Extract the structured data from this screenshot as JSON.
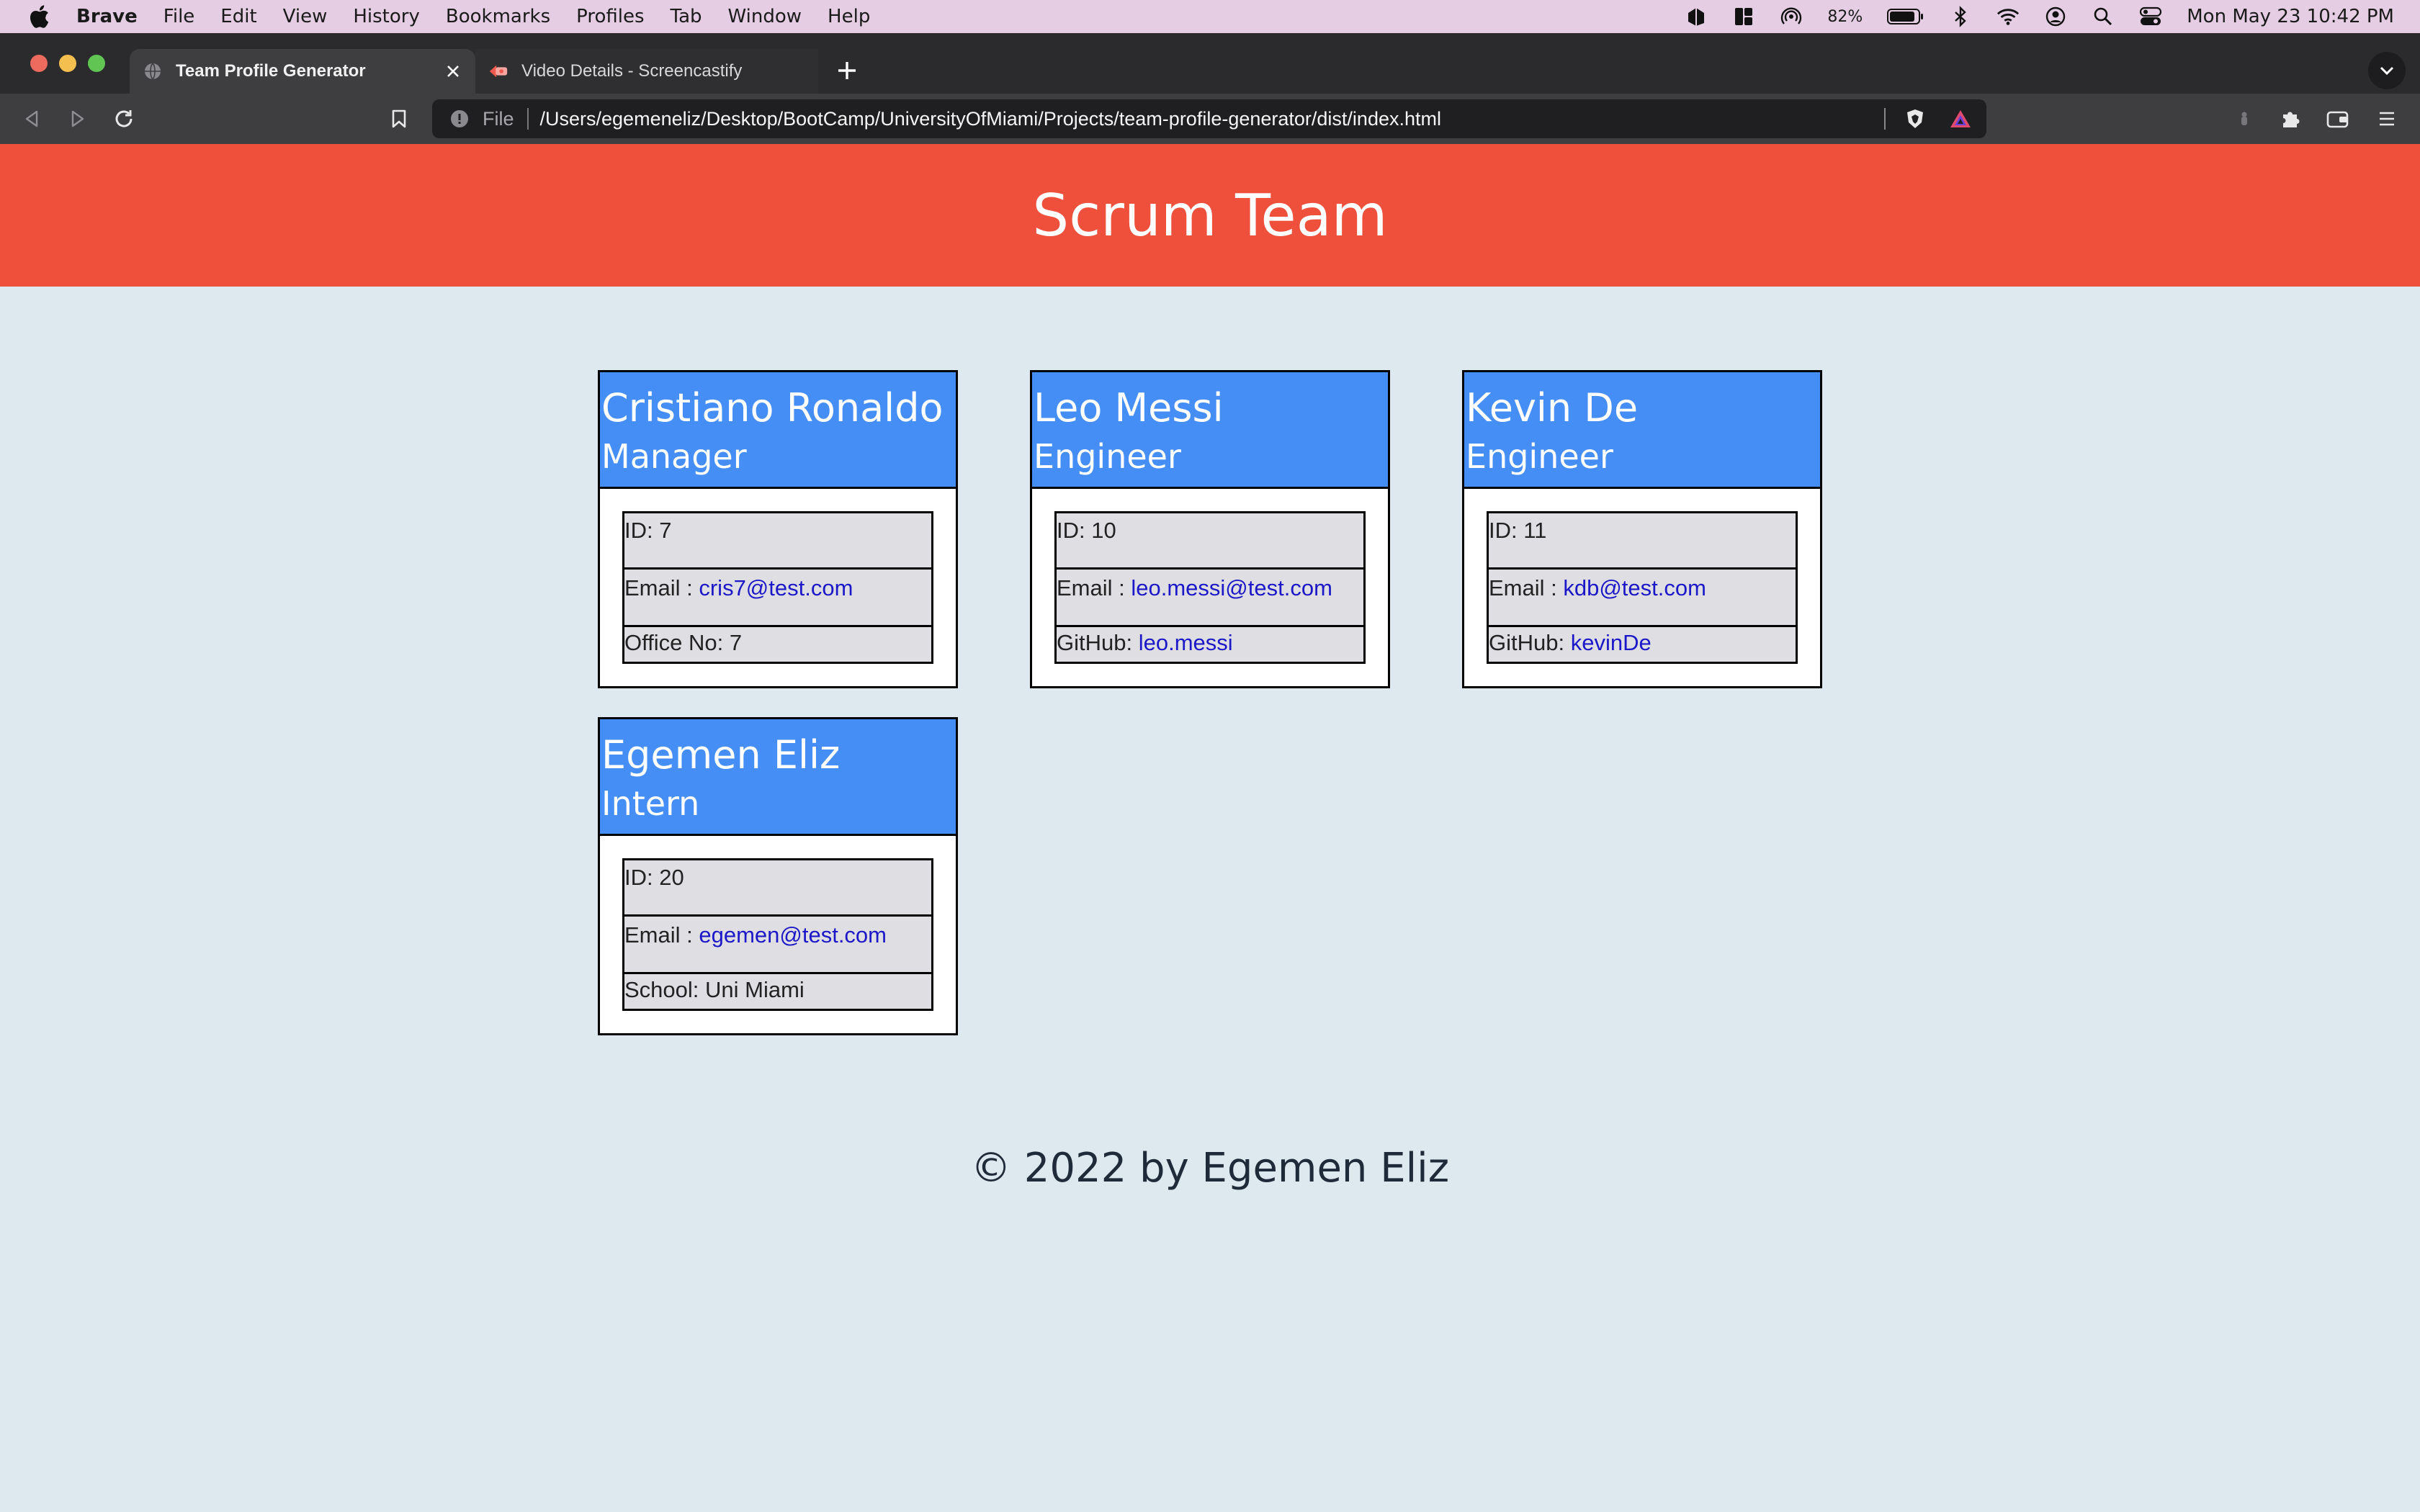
{
  "menubar": {
    "app_name": "Brave",
    "items": [
      "File",
      "Edit",
      "View",
      "History",
      "Bookmarks",
      "Profiles",
      "Tab",
      "Window",
      "Help"
    ],
    "battery_percent": "82%",
    "clock": "Mon May 23  10:42 PM"
  },
  "browser": {
    "tabs": [
      {
        "title": "Team Profile Generator",
        "icon": "globe-icon",
        "active": true
      },
      {
        "title": "Video Details - Screencastify",
        "icon": "screencastify-icon",
        "active": false
      }
    ],
    "address": {
      "scheme": "File",
      "url": "/Users/egemeneliz/Desktop/BootCamp/UniversityOfMiami/Projects/team-profile-generator/dist/index.html"
    }
  },
  "page": {
    "title": "Scrum Team",
    "cards": [
      {
        "name": "Cristiano Ronaldo",
        "role": "Manager",
        "id_label": "ID: 7",
        "email_label": "Email : ",
        "email": "cris7@test.com",
        "extra_label": "Office No: 7",
        "extra_link": ""
      },
      {
        "name": "Leo Messi",
        "role": "Engineer",
        "id_label": "ID: 10",
        "email_label": "Email : ",
        "email": "leo.messi@test.com",
        "extra_label": "GitHub: ",
        "extra_link": "leo.messi"
      },
      {
        "name": "Kevin De",
        "role": "Engineer",
        "id_label": "ID: 11",
        "email_label": "Email : ",
        "email": "kdb@test.com",
        "extra_label": "GitHub: ",
        "extra_link": "kevinDe"
      },
      {
        "name": "Egemen Eliz",
        "role": "Intern",
        "id_label": "ID: 20",
        "email_label": "Email : ",
        "email": "egemen@test.com",
        "extra_label": "School: Uni Miami",
        "extra_link": ""
      }
    ],
    "footer": "© 2022 by Egemen Eliz"
  },
  "colors": {
    "header_bg": "#ee503c",
    "card_head_bg": "#448ef6",
    "page_bg": "#dee8ef",
    "link": "#1c18c8"
  }
}
